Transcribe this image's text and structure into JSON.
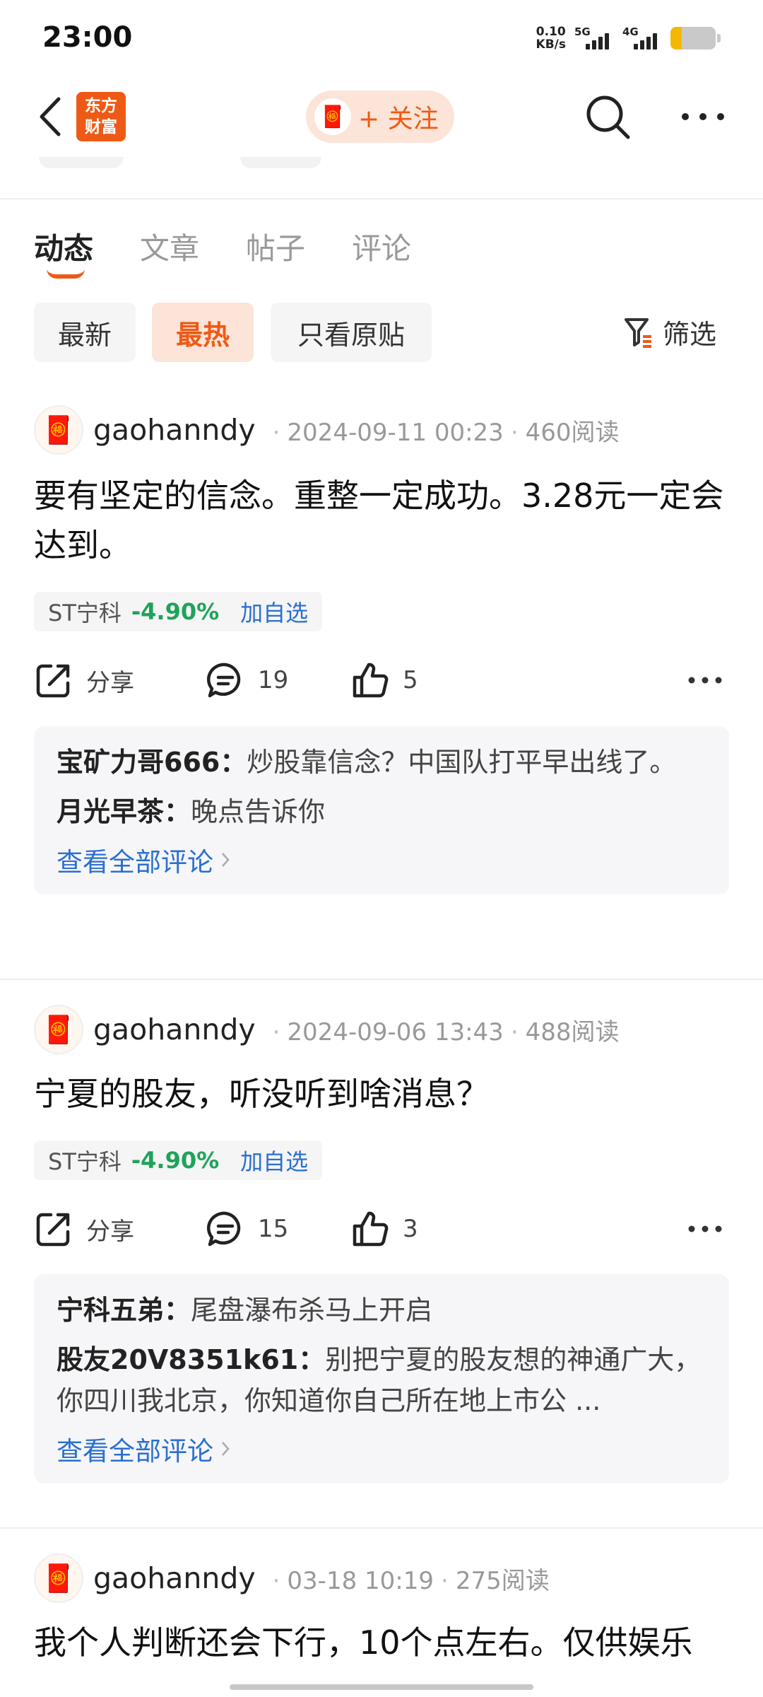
{
  "status_bar": {
    "time": "23:00",
    "net_speed_value": "0.10",
    "net_speed_unit": "KB/s",
    "sim1_label": "5G",
    "sim2_label": "4G",
    "battery_level": 0.25,
    "battery_color": "#f5b800"
  },
  "header": {
    "back_icon": "chevron-left-icon",
    "logo_line1": "东方",
    "logo_line2": "财富",
    "follow_label": "+ 关注",
    "search_icon": "search-icon",
    "more_icon": "more-horizontal-icon",
    "accent_color": "#ee5a16"
  },
  "tabs": [
    {
      "label": "动态",
      "active": true
    },
    {
      "label": "文章",
      "active": false
    },
    {
      "label": "帖子",
      "active": false
    },
    {
      "label": "评论",
      "active": false
    }
  ],
  "filters": {
    "chips": [
      {
        "label": "最新",
        "active": false
      },
      {
        "label": "最热",
        "active": true
      },
      {
        "label": "只看原贴",
        "active": false
      }
    ],
    "filter_label": "筛选"
  },
  "posts": [
    {
      "author": "gaohanndy",
      "date": "2024-09-11 00:23",
      "reads": "460阅读",
      "text": "要有坚定的信念。重整一定成功。3.28元一定会达到。",
      "stock": {
        "name": "ST宁科",
        "change": "-4.90%",
        "add_label": "加自选"
      },
      "share_label": "分享",
      "comment_count": "19",
      "like_count": "5",
      "comments": [
        {
          "user": "宝矿力哥666：",
          "text": "炒股靠信念？中国队打平早出线了。"
        },
        {
          "user": "月光早茶：",
          "text": "晚点告诉你"
        }
      ],
      "view_all_label": "查看全部评论"
    },
    {
      "author": "gaohanndy",
      "date": "2024-09-06 13:43",
      "reads": "488阅读",
      "text": "宁夏的股友，听没听到啥消息？",
      "stock": {
        "name": "ST宁科",
        "change": "-4.90%",
        "add_label": "加自选"
      },
      "share_label": "分享",
      "comment_count": "15",
      "like_count": "3",
      "comments": [
        {
          "user": "宁科五弟：",
          "text": "尾盘瀑布杀马上开启"
        },
        {
          "user": "股友20V8351k61：",
          "text": "别把宁夏的股友想的神通广大，你四川我北京，你知道你自己所在地上市公 ..."
        }
      ],
      "view_all_label": "查看全部评论"
    },
    {
      "author": "gaohanndy",
      "date": "03-18 10:19",
      "reads": "275阅读",
      "text": "我个人判断还会下行，10个点左右。仅供娱乐"
    }
  ]
}
